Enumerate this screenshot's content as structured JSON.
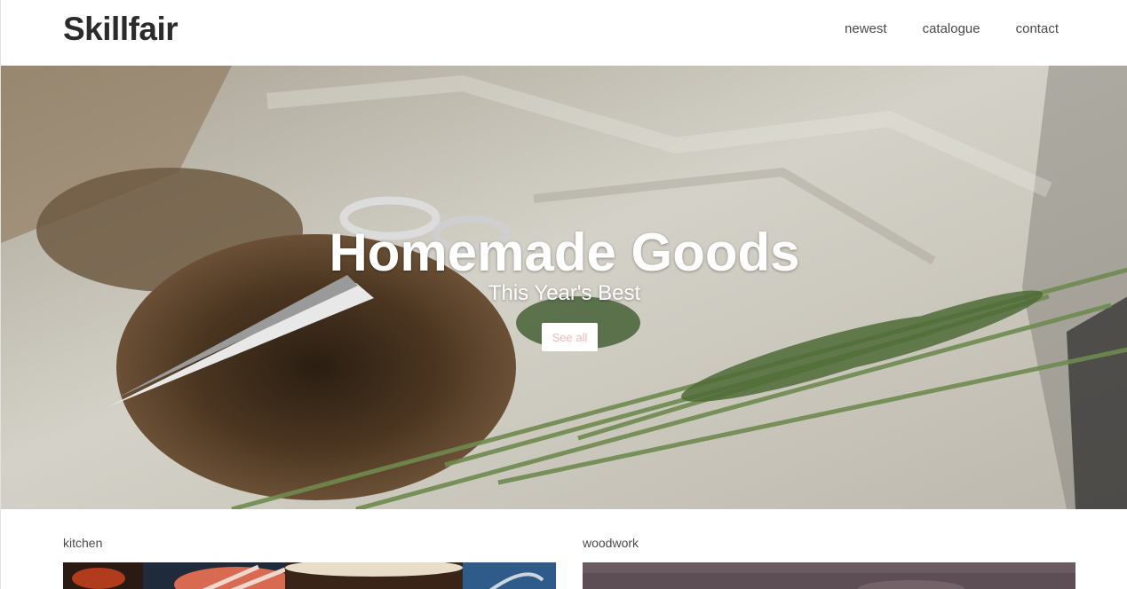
{
  "header": {
    "logo": "Skillfair",
    "nav": [
      {
        "label": "newest"
      },
      {
        "label": "catalogue"
      },
      {
        "label": "contact"
      }
    ]
  },
  "hero": {
    "title": "Homemade Goods",
    "subtitle": "This Year's Best",
    "button_label": "See all"
  },
  "categories": [
    {
      "label": "kitchen"
    },
    {
      "label": "woodwork"
    }
  ],
  "colors": {
    "accent_button_text": "#f2b8b8",
    "text_dark": "#2b2b2b",
    "background": "#ffffff"
  }
}
